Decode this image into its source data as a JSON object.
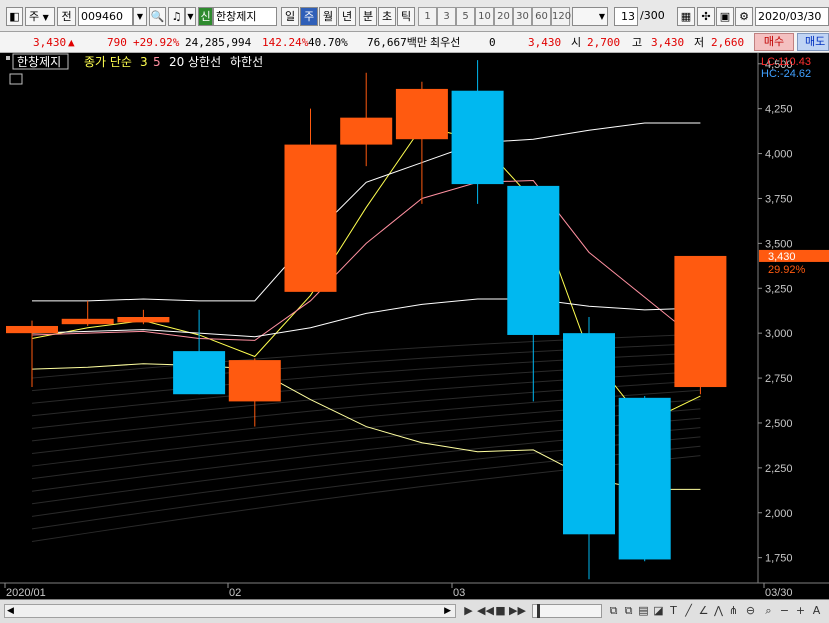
{
  "toolbar": {
    "market_type": "주",
    "prev_label": "전",
    "stock_code": "009460",
    "badge": "신",
    "stock_name": "한창제지",
    "period_tabs": [
      {
        "label": "일",
        "active": false
      },
      {
        "label": "주",
        "active": true
      },
      {
        "label": "월",
        "active": false
      },
      {
        "label": "년",
        "active": false
      },
      {
        "label": "분",
        "active": false
      },
      {
        "label": "초",
        "active": false
      },
      {
        "label": "틱",
        "active": false
      }
    ],
    "intervals": [
      "1",
      "3",
      "5",
      "10",
      "20",
      "30",
      "60",
      "120"
    ],
    "count_value": "13",
    "count_total": "/300",
    "date_value": "2020/03/30",
    "buy_label": "매수",
    "sell_label": "매도"
  },
  "quote": {
    "price": "3,430",
    "change": "790",
    "change_pct": "+29.92%",
    "volume": "24,285,994",
    "volume_ratio": "142.24%",
    "turnover": "40.70%",
    "amount": "76,667백만",
    "pref_label": "최우선",
    "pref_value": "0",
    "pref_price": "3,430",
    "open_label": "시",
    "open": "2,700",
    "high_label": "고",
    "high": "3,430",
    "low_label": "저",
    "low": "2,660"
  },
  "chart_data": {
    "type": "candlestick",
    "title": "한창제지",
    "legend": [
      "종가 단순",
      "3",
      "5",
      "20",
      "상한선",
      "하한선"
    ],
    "lc_label": "LC:110.43",
    "hc_label": "HC:-24.62",
    "y_ticks": [
      "4,500",
      "4,250",
      "4,000",
      "3,750",
      "3,500",
      "3,250",
      "3,000",
      "2,750",
      "2,500",
      "2,250",
      "2,000",
      "1,750"
    ],
    "ylim": [
      1620,
      4560
    ],
    "x_labels": [
      "2020/01",
      "02",
      "03",
      "03/30"
    ],
    "current_price_label": "3,430",
    "current_pct_label": "29.92%",
    "candles": [
      {
        "open": 3000,
        "close": 3040,
        "high": 3070,
        "low": 2700
      },
      {
        "open": 3050,
        "close": 3080,
        "high": 3180,
        "low": 3040
      },
      {
        "open": 3060,
        "close": 3090,
        "high": 3130,
        "low": 3050
      },
      {
        "open": 2900,
        "close": 2660,
        "high": 3130,
        "low": 2660
      },
      {
        "open": 2620,
        "close": 2850,
        "high": 2860,
        "low": 2480
      },
      {
        "open": 3230,
        "close": 4050,
        "high": 4250,
        "low": 3230
      },
      {
        "open": 4050,
        "close": 4200,
        "high": 4450,
        "low": 3930
      },
      {
        "open": 4080,
        "close": 4360,
        "high": 4400,
        "low": 3720
      },
      {
        "open": 4350,
        "close": 3830,
        "high": 4520,
        "low": 3720
      },
      {
        "open": 3820,
        "close": 2990,
        "high": 3820,
        "low": 2620
      },
      {
        "open": 3000,
        "close": 1880,
        "high": 3090,
        "low": 1630
      },
      {
        "open": 2640,
        "close": 1740,
        "high": 2650,
        "low": 1730
      },
      {
        "open": 2700,
        "close": 3430,
        "high": 3430,
        "low": 2660
      }
    ],
    "series": [
      {
        "name": "3",
        "color": "#ffff50",
        "values": [
          2970,
          3030,
          3070,
          2990,
          2870,
          3210,
          3700,
          4150,
          4080,
          3740,
          2890,
          2500,
          2650
        ]
      },
      {
        "name": "5",
        "color": "#ff90a0",
        "values": [
          2990,
          3000,
          3010,
          2970,
          2960,
          3180,
          3500,
          3750,
          3840,
          3850,
          3450,
          3200,
          2950
        ]
      },
      {
        "name": "20",
        "color": "#ffffff",
        "values": [
          3000,
          3010,
          3020,
          3000,
          2980,
          3030,
          3110,
          3160,
          3190,
          3190,
          3150,
          3130,
          3140
        ]
      },
      {
        "name": "상한선",
        "color": "#ffffff",
        "values": [
          3180,
          3180,
          3190,
          3180,
          3180,
          3530,
          3840,
          3950,
          4060,
          4080,
          4130,
          4170,
          4170
        ]
      },
      {
        "name": "하한선",
        "color": "#ffffa0",
        "values": [
          2800,
          2810,
          2830,
          2820,
          2800,
          2630,
          2480,
          2390,
          2340,
          2350,
          2190,
          2130,
          2130
        ]
      }
    ]
  },
  "colors": {
    "up": "#ff5a10",
    "down": "#00b8f0",
    "background": "#000000"
  }
}
